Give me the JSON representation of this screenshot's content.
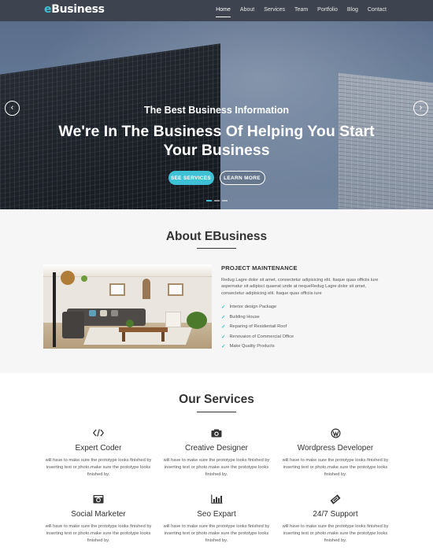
{
  "nav": {
    "logo_e": "e",
    "logo_rest": "Business",
    "items": [
      {
        "label": "Home",
        "active": true
      },
      {
        "label": "About"
      },
      {
        "label": "Services"
      },
      {
        "label": "Team"
      },
      {
        "label": "Portfolio"
      },
      {
        "label": "Blog"
      },
      {
        "label": "Contact"
      }
    ]
  },
  "hero": {
    "subtitle": "The Best Business Information",
    "title": "We're In The Business Of Helping You Start Your Business",
    "primary_button": "SEE SERVICES",
    "secondary_button": "LEARN MORE",
    "prev_arrow": "‹",
    "next_arrow": "›"
  },
  "about": {
    "title": "About EBusiness",
    "heading": "PROJECT MAINTENANCE",
    "description": "Redug Lagre dolor sit amet, consectetur adipisicing elit. Itaque quas officiis iure aspernatur sit adipisci quaerat unde at nequeRedug Lagre dolor sit amet, consectetur adipisicing elit. Itaque quas officiis iure",
    "list": [
      "Interior design Package",
      "Building House",
      "Reparing of Residentail Roof",
      "Renovaion of Commercial Office",
      "Make Quality Products"
    ],
    "check_icon": "check-icon"
  },
  "services": {
    "title": "Our Services",
    "items": [
      {
        "title": "Expert Coder",
        "icon": "code-icon",
        "desc": "will have to make sure the prototype looks finished by inserting text or photo.make sure the prototype looks finished by."
      },
      {
        "title": "Creative Designer",
        "icon": "camera-icon",
        "desc": "will have to make sure the prototype looks finished by inserting text or photo.make sure the prototype looks finished by."
      },
      {
        "title": "Wordpress Developer",
        "icon": "wordpress-icon",
        "desc": "will have to make sure the prototype looks finished by inserting text or photo.make sure the prototype looks finished by."
      },
      {
        "title": "Social Marketer",
        "icon": "camera-retro-icon",
        "desc": "will have to make sure the prototype looks finished by inserting text or photo.make sure the prototype looks finished by."
      },
      {
        "title": "Seo Expart",
        "icon": "bar-chart-icon",
        "desc": "will have to make sure the prototype looks finished by inserting text or photo.make sure the prototype looks finished by."
      },
      {
        "title": "24/7 Support",
        "icon": "ticket-icon",
        "desc": "will have to make sure the prototype looks finished by inserting text or photo.make sure the prototype looks finished by."
      }
    ]
  },
  "colors": {
    "accent": "#3ec1d5",
    "nav_bg": "#3d4450",
    "about_bg": "#f6f6f6"
  }
}
